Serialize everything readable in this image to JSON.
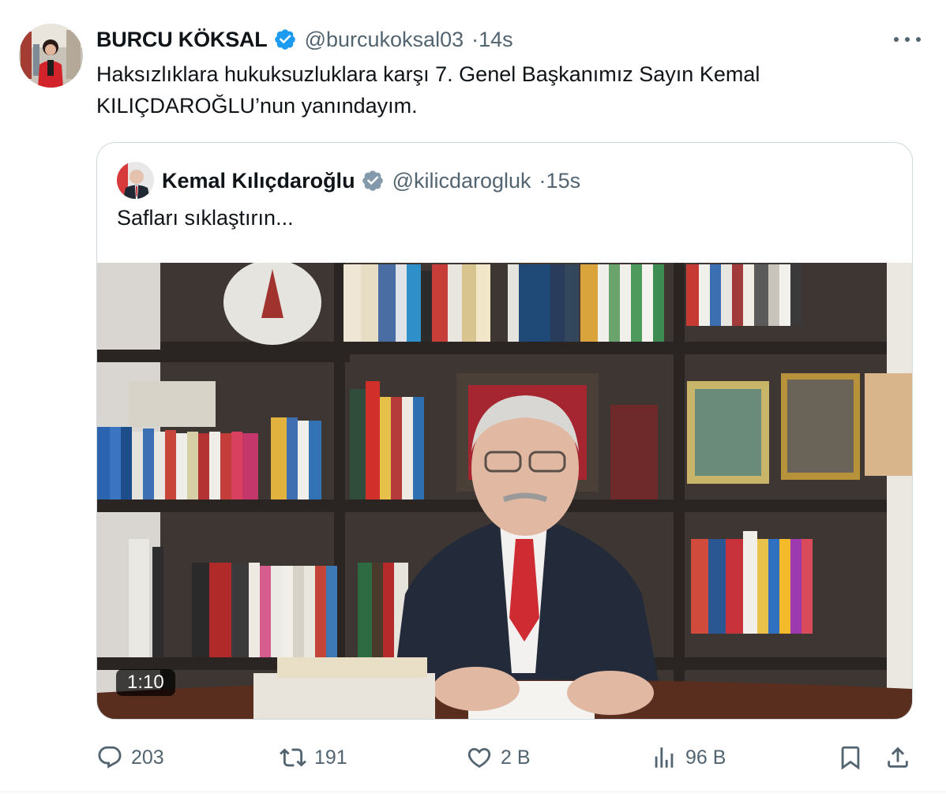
{
  "tweet": {
    "author_name": "BURCU KÖKSAL",
    "author_handle": "@burcukoksal03",
    "time": "14s",
    "text_line1": "Haksızlıklara hukuksuzluklara karşı 7. Genel Başkanımız Sayın Kemal",
    "text_line2": "KILIÇDAROĞLU’nun yanındayım.",
    "header_suffix": "· "
  },
  "quote": {
    "author_name": "Kemal Kılıçdaroğlu",
    "author_handle": "@kilicdarogluk",
    "time": "15s",
    "text": "Safları sıklaştırın...",
    "video_duration": "1:10"
  },
  "actions": {
    "replies": "203",
    "retweets": "191",
    "likes": "2 B",
    "views": "96 B"
  },
  "icons": [
    "verified-badge-icon",
    "more-icon",
    "reply-icon",
    "retweet-icon",
    "like-icon",
    "views-icon",
    "bookmark-icon",
    "share-icon"
  ],
  "colors": {
    "verified": "#1d9bf0",
    "quote_verified": "#829aab",
    "secondary_text": "#536471",
    "border": "#cfd9de"
  }
}
